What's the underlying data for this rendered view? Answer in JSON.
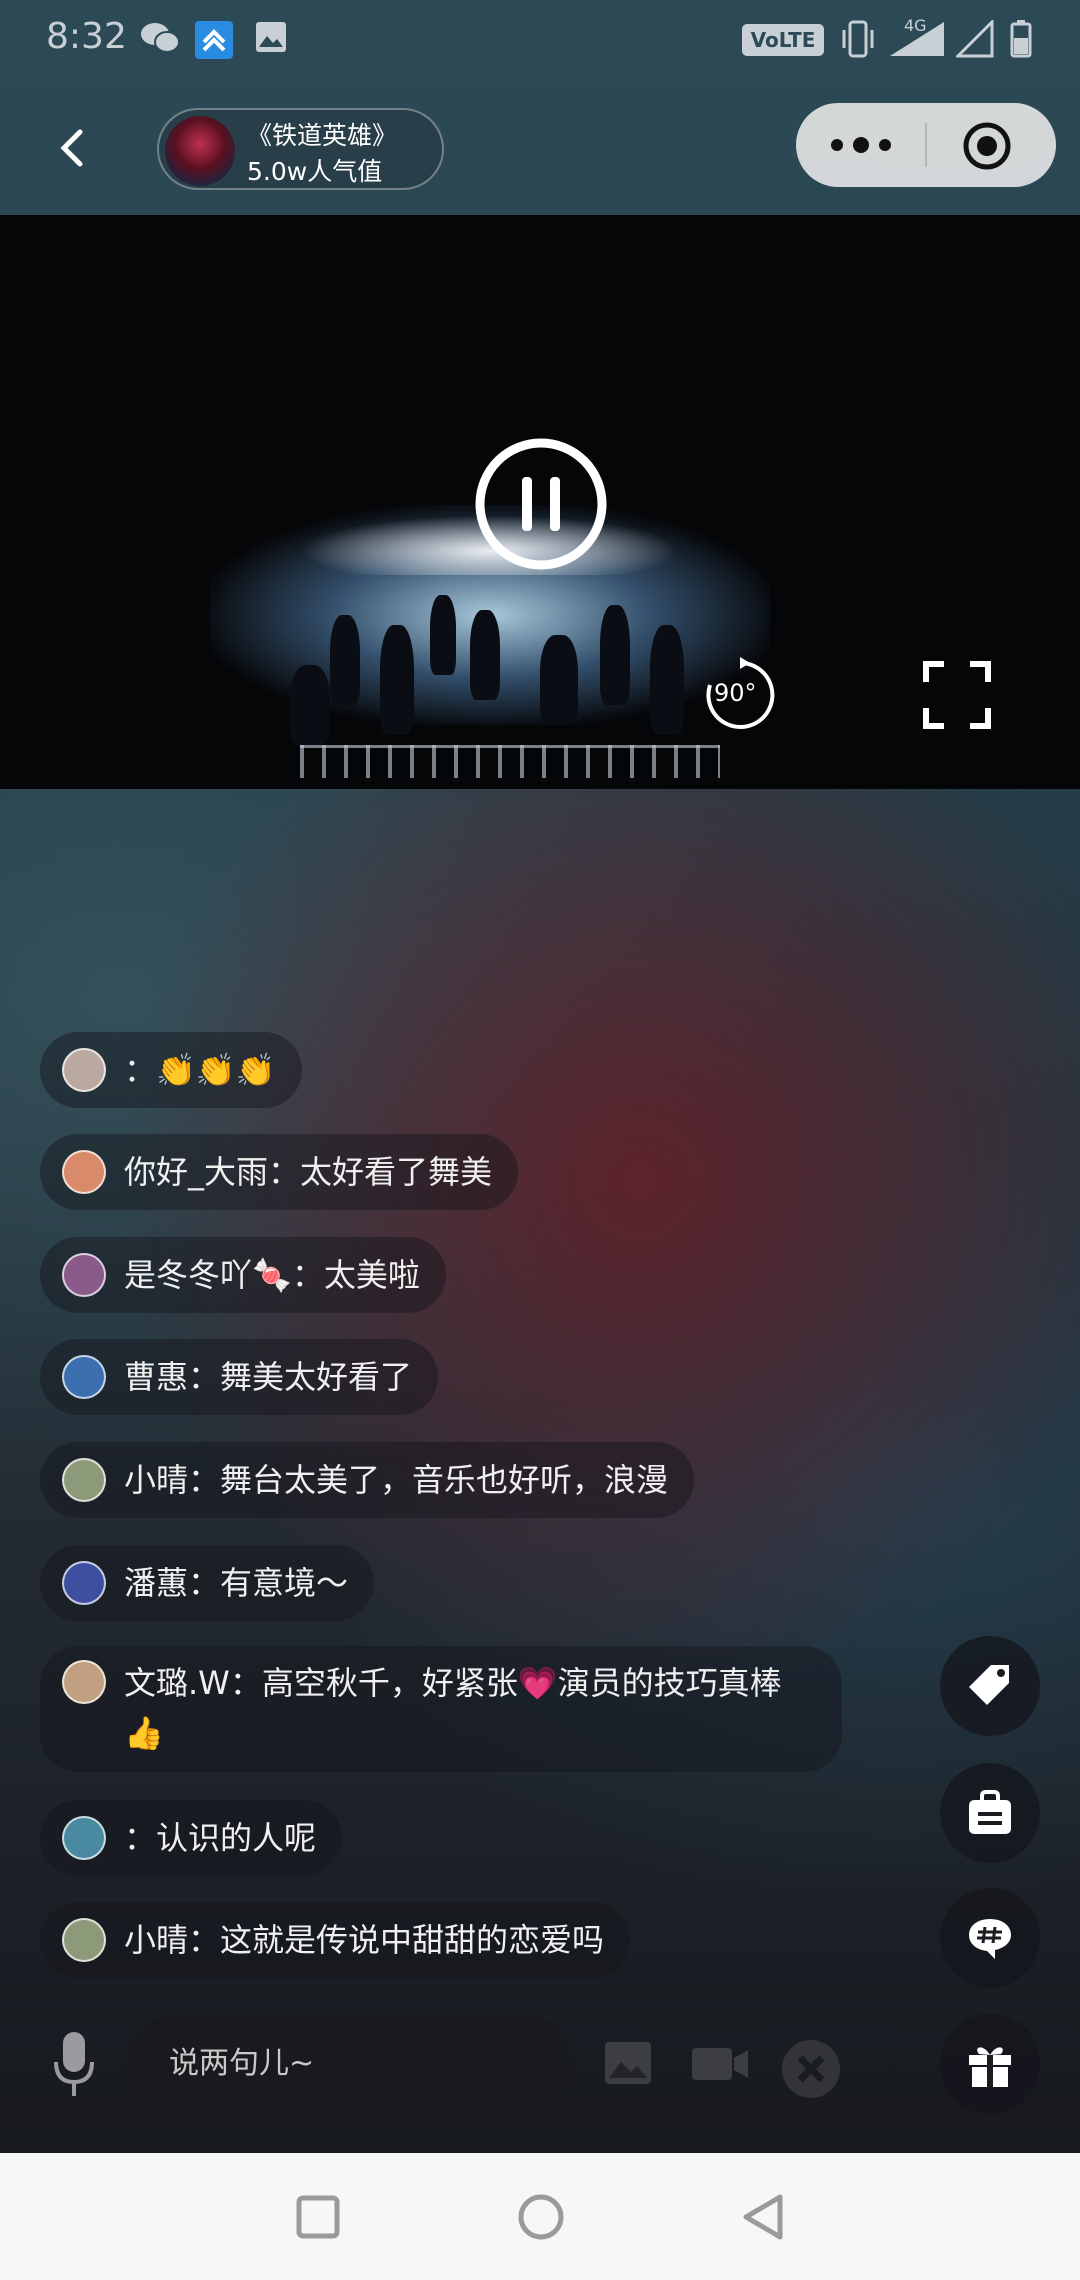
{
  "status_bar": {
    "time": "8:32",
    "network_label": "VoLTE 1",
    "network_gen": "4G"
  },
  "header": {
    "title": "《铁道英雄》",
    "popularity": "5.0w人气值"
  },
  "video": {
    "rotate_label": "90°"
  },
  "comments": [
    {
      "name": "",
      "text": "：👏👏👏",
      "avatar_color": "#b9a9a0"
    },
    {
      "name": "你好_大雨",
      "text": "你好_大雨：太好看了舞美",
      "avatar_color": "#d88a6a"
    },
    {
      "name": "是冬冬吖🍬",
      "text": "是冬冬吖🍬：太美啦",
      "avatar_color": "#8a5a8a"
    },
    {
      "name": "曹惠",
      "text": "曹惠：舞美太好看了",
      "avatar_color": "#3b6fb0"
    },
    {
      "name": "小晴",
      "text": "小晴：舞台太美了，音乐也好听，浪漫",
      "avatar_color": "#8c9a7a"
    },
    {
      "name": "潘蕙",
      "text": "潘蕙：有意境～",
      "avatar_color": "#3f4fa0"
    },
    {
      "name": "文璐.W",
      "text": "文璐.W：高空秋千，好紧张💗演员的技巧真棒👍",
      "avatar_color": "#c0a080"
    },
    {
      "name": "",
      "text": "：认识的人呢",
      "avatar_color": "#4a8aa0"
    },
    {
      "name": "小晴",
      "text": "小晴：这就是传说中甜甜的恋爱吗",
      "avatar_color": "#8c9a7a"
    }
  ],
  "input": {
    "placeholder": "说两句儿~"
  },
  "icons": {
    "back": "back-chevron-icon",
    "more": "more-dots-icon",
    "close": "target-circle-icon",
    "pause": "pause-icon",
    "rotate": "rotate-90-icon",
    "fullscreen": "fullscreen-icon",
    "tag": "tag-icon",
    "shop": "shopping-bag-icon",
    "topic": "hashtag-chat-icon",
    "gift": "gift-icon",
    "mic": "microphone-icon",
    "image": "image-icon",
    "camera": "video-camera-icon"
  }
}
